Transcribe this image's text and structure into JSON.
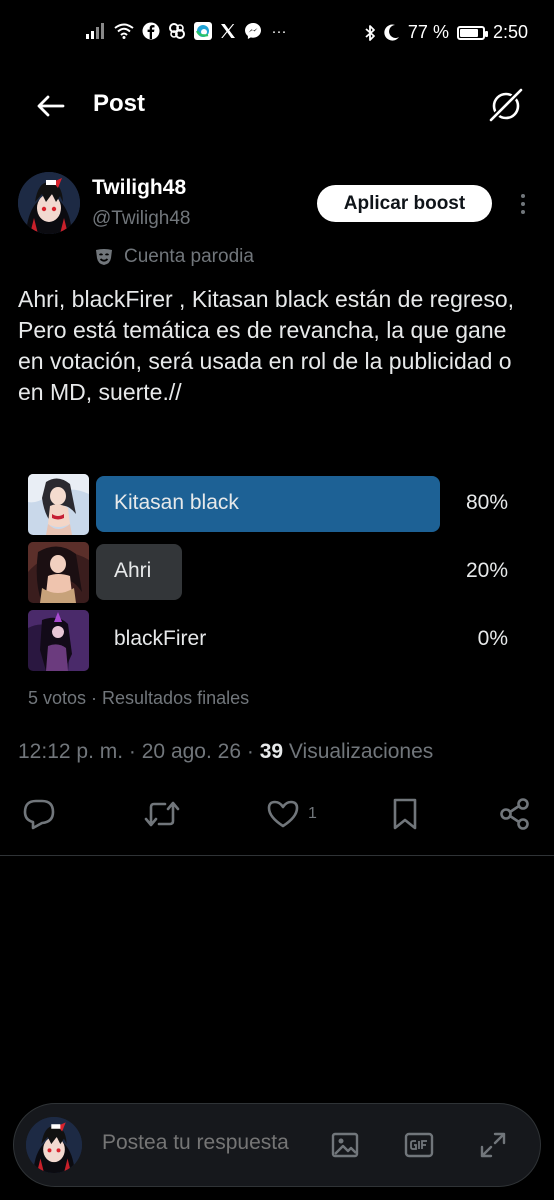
{
  "status_bar": {
    "time": "2:50",
    "battery_text": "77 %",
    "battery_level_percent": 77,
    "more_notifications": "···"
  },
  "header": {
    "title": "Post",
    "back_icon": "arrow-left-icon",
    "grok_icon": "grok-icon"
  },
  "author": {
    "name": "Twiligh48",
    "handle": "@Twiligh48",
    "parody_label": "Cuenta parodia",
    "boost_label": "Aplicar boost"
  },
  "post": {
    "text": "Ahri, blackFirer , Kitasan black están de regreso, Pero está temática es de revancha, la que gane en votación, será usada en rol de la publicidad o en MD, suerte.//"
  },
  "poll": {
    "options": [
      {
        "label": "Kitasan black",
        "percent_text": "80%",
        "percent": 80,
        "winner": true
      },
      {
        "label": "Ahri",
        "percent_text": "20%",
        "percent": 20,
        "winner": false
      },
      {
        "label": "blackFirer",
        "percent_text": "0%",
        "percent": 0,
        "winner": false
      }
    ],
    "meta": "5 votos · Resultados finales"
  },
  "meta_line": {
    "time": "12:12 p. m.",
    "date": "20 ago. 26",
    "views_count": "39",
    "views_label": "Visualizaciones",
    "separator": "·"
  },
  "actions": {
    "like_count": "1"
  },
  "reply": {
    "placeholder": "Postea tu respuesta"
  },
  "colors": {
    "background": "#000000",
    "accent_bar": "#1d6195",
    "loser_bar": "#333639",
    "muted": "#71767b"
  }
}
